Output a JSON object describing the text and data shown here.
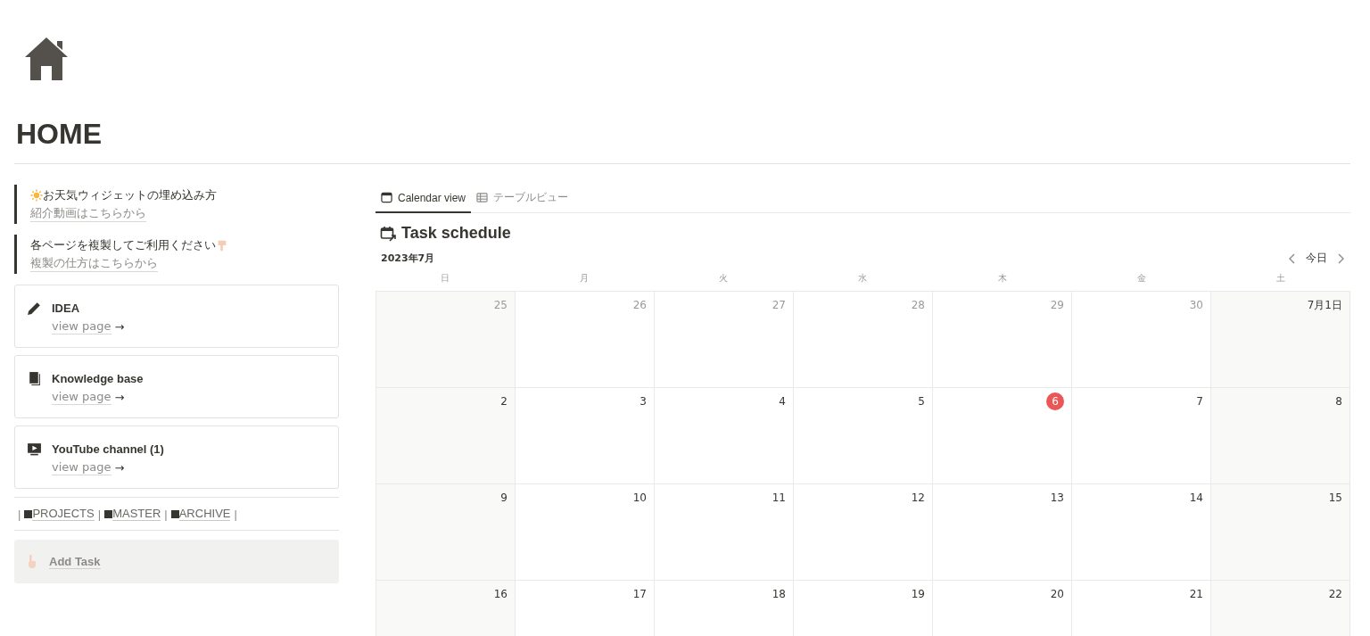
{
  "page": {
    "title": "HOME"
  },
  "callouts": [
    {
      "title": "お天気ウィジェットの埋め込み方",
      "link": "紹介動画はこちらから",
      "kind": "sun"
    },
    {
      "title": "各ページを複製してご利用ください",
      "link": "複製の仕方はこちらから",
      "kind": "hand"
    }
  ],
  "cards": [
    {
      "title": "IDEA",
      "link": "view page",
      "arrow": "→",
      "kind": "pencil"
    },
    {
      "title": "Knowledge base",
      "link": "view page",
      "arrow": "→",
      "kind": "book"
    },
    {
      "title": "YouTube channel (1)",
      "link": "view page",
      "arrow": "→",
      "kind": "screen"
    }
  ],
  "nav_links": [
    {
      "sep": "|",
      "label": "PROJECTS"
    },
    {
      "sep": "|",
      "label": "MASTER"
    },
    {
      "sep": "|",
      "label": "ARCHIVE"
    }
  ],
  "nav_end": "|",
  "add_task": {
    "label": "Add Task"
  },
  "tabs": [
    {
      "label": "Calendar view",
      "kind": "calendar",
      "selected": true
    },
    {
      "label": "テーブルビュー",
      "kind": "table",
      "selected": false
    }
  ],
  "calendar": {
    "title": "Task schedule",
    "month": "2023年7月",
    "today_button": "今日",
    "weekdays": [
      "日",
      "月",
      "火",
      "水",
      "木",
      "金",
      "土"
    ],
    "weeks": [
      [
        {
          "day": "25",
          "in_month": false,
          "today": false
        },
        {
          "day": "26",
          "in_month": false,
          "today": false
        },
        {
          "day": "27",
          "in_month": false,
          "today": false
        },
        {
          "day": "28",
          "in_month": false,
          "today": false
        },
        {
          "day": "29",
          "in_month": false,
          "today": false
        },
        {
          "day": "30",
          "in_month": false,
          "today": false
        },
        {
          "day": "7月1日",
          "in_month": true,
          "today": false
        }
      ],
      [
        {
          "day": "2",
          "in_month": true,
          "today": false
        },
        {
          "day": "3",
          "in_month": true,
          "today": false
        },
        {
          "day": "4",
          "in_month": true,
          "today": false
        },
        {
          "day": "5",
          "in_month": true,
          "today": false
        },
        {
          "day": "6",
          "in_month": true,
          "today": true
        },
        {
          "day": "7",
          "in_month": true,
          "today": false
        },
        {
          "day": "8",
          "in_month": true,
          "today": false
        }
      ],
      [
        {
          "day": "9",
          "in_month": true,
          "today": false
        },
        {
          "day": "10",
          "in_month": true,
          "today": false
        },
        {
          "day": "11",
          "in_month": true,
          "today": false
        },
        {
          "day": "12",
          "in_month": true,
          "today": false
        },
        {
          "day": "13",
          "in_month": true,
          "today": false
        },
        {
          "day": "14",
          "in_month": true,
          "today": false
        },
        {
          "day": "15",
          "in_month": true,
          "today": false
        }
      ],
      [
        {
          "day": "16",
          "in_month": true,
          "today": false
        },
        {
          "day": "17",
          "in_month": true,
          "today": false
        },
        {
          "day": "18",
          "in_month": true,
          "today": false
        },
        {
          "day": "19",
          "in_month": true,
          "today": false
        },
        {
          "day": "20",
          "in_month": true,
          "today": false
        },
        {
          "day": "21",
          "in_month": true,
          "today": false
        },
        {
          "day": "22",
          "in_month": true,
          "today": false
        }
      ]
    ]
  }
}
